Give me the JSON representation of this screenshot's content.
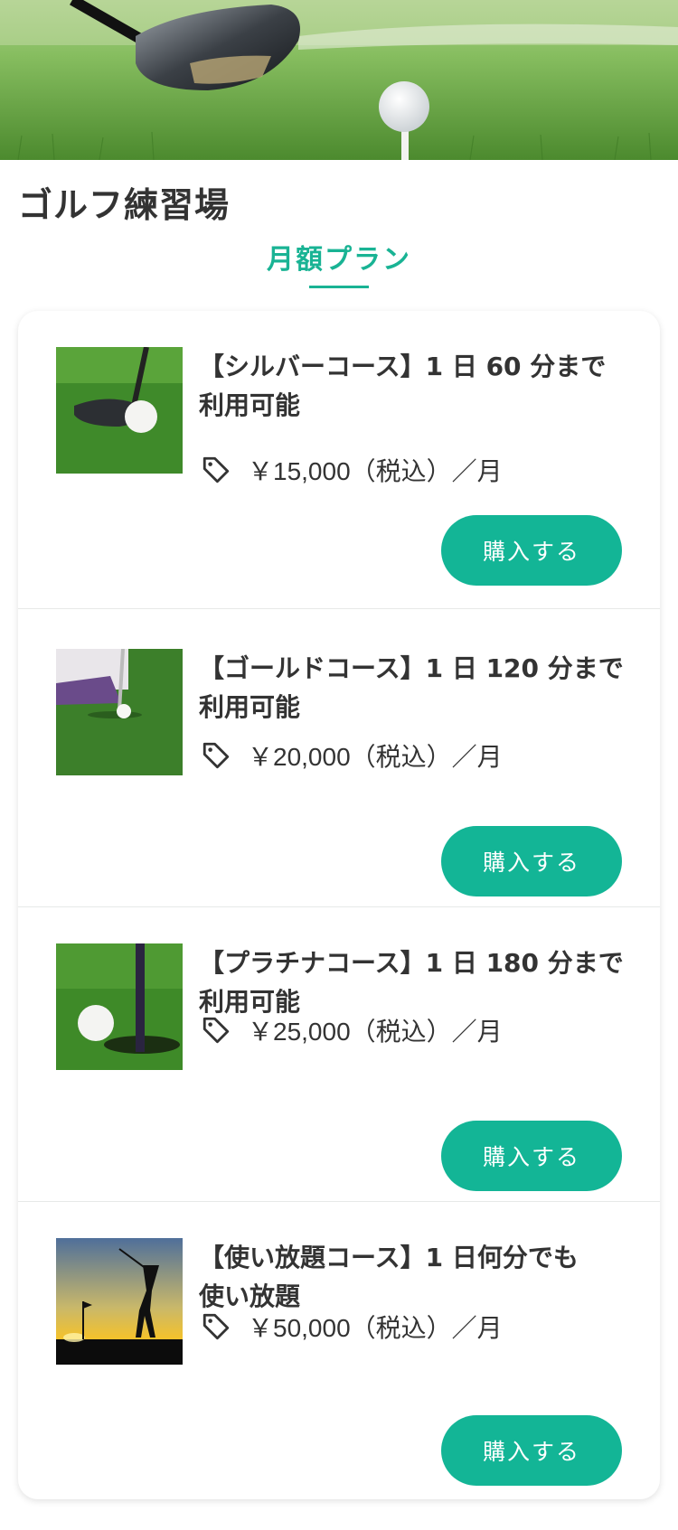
{
  "header": {
    "title": "ゴルフ練習場"
  },
  "tabs": [
    {
      "label": "月額プラン",
      "active": true
    }
  ],
  "colors": {
    "accent": "#13b596",
    "text": "#333333"
  },
  "plans": [
    {
      "title_line1": "【シルバーコース】1 日 60 分まで",
      "title_line2": "利用可能",
      "price": "￥15,000（税込）／月",
      "button": "購入する",
      "image": "golf-driver-ball-photo"
    },
    {
      "title_line1": "【ゴールドコース】1 日 120 分まで",
      "title_line2": "利用可能",
      "price": "￥20,000（税込）／月",
      "button": "購入する",
      "image": "golf-putting-feet-photo"
    },
    {
      "title_line1": "【プラチナコース】1 日 180 分まで",
      "title_line2": "利用可能",
      "price": "￥25,000（税込）／月",
      "button": "購入する",
      "image": "golf-ball-hole-photo"
    },
    {
      "title_line1": "【使い放題コース】1 日何分でも",
      "title_line2": "使い放題",
      "price": "￥50,000（税込）／月",
      "button": "購入する",
      "image": "golfer-sunset-silhouette-photo"
    }
  ],
  "icons": {
    "price": "tag-icon"
  }
}
